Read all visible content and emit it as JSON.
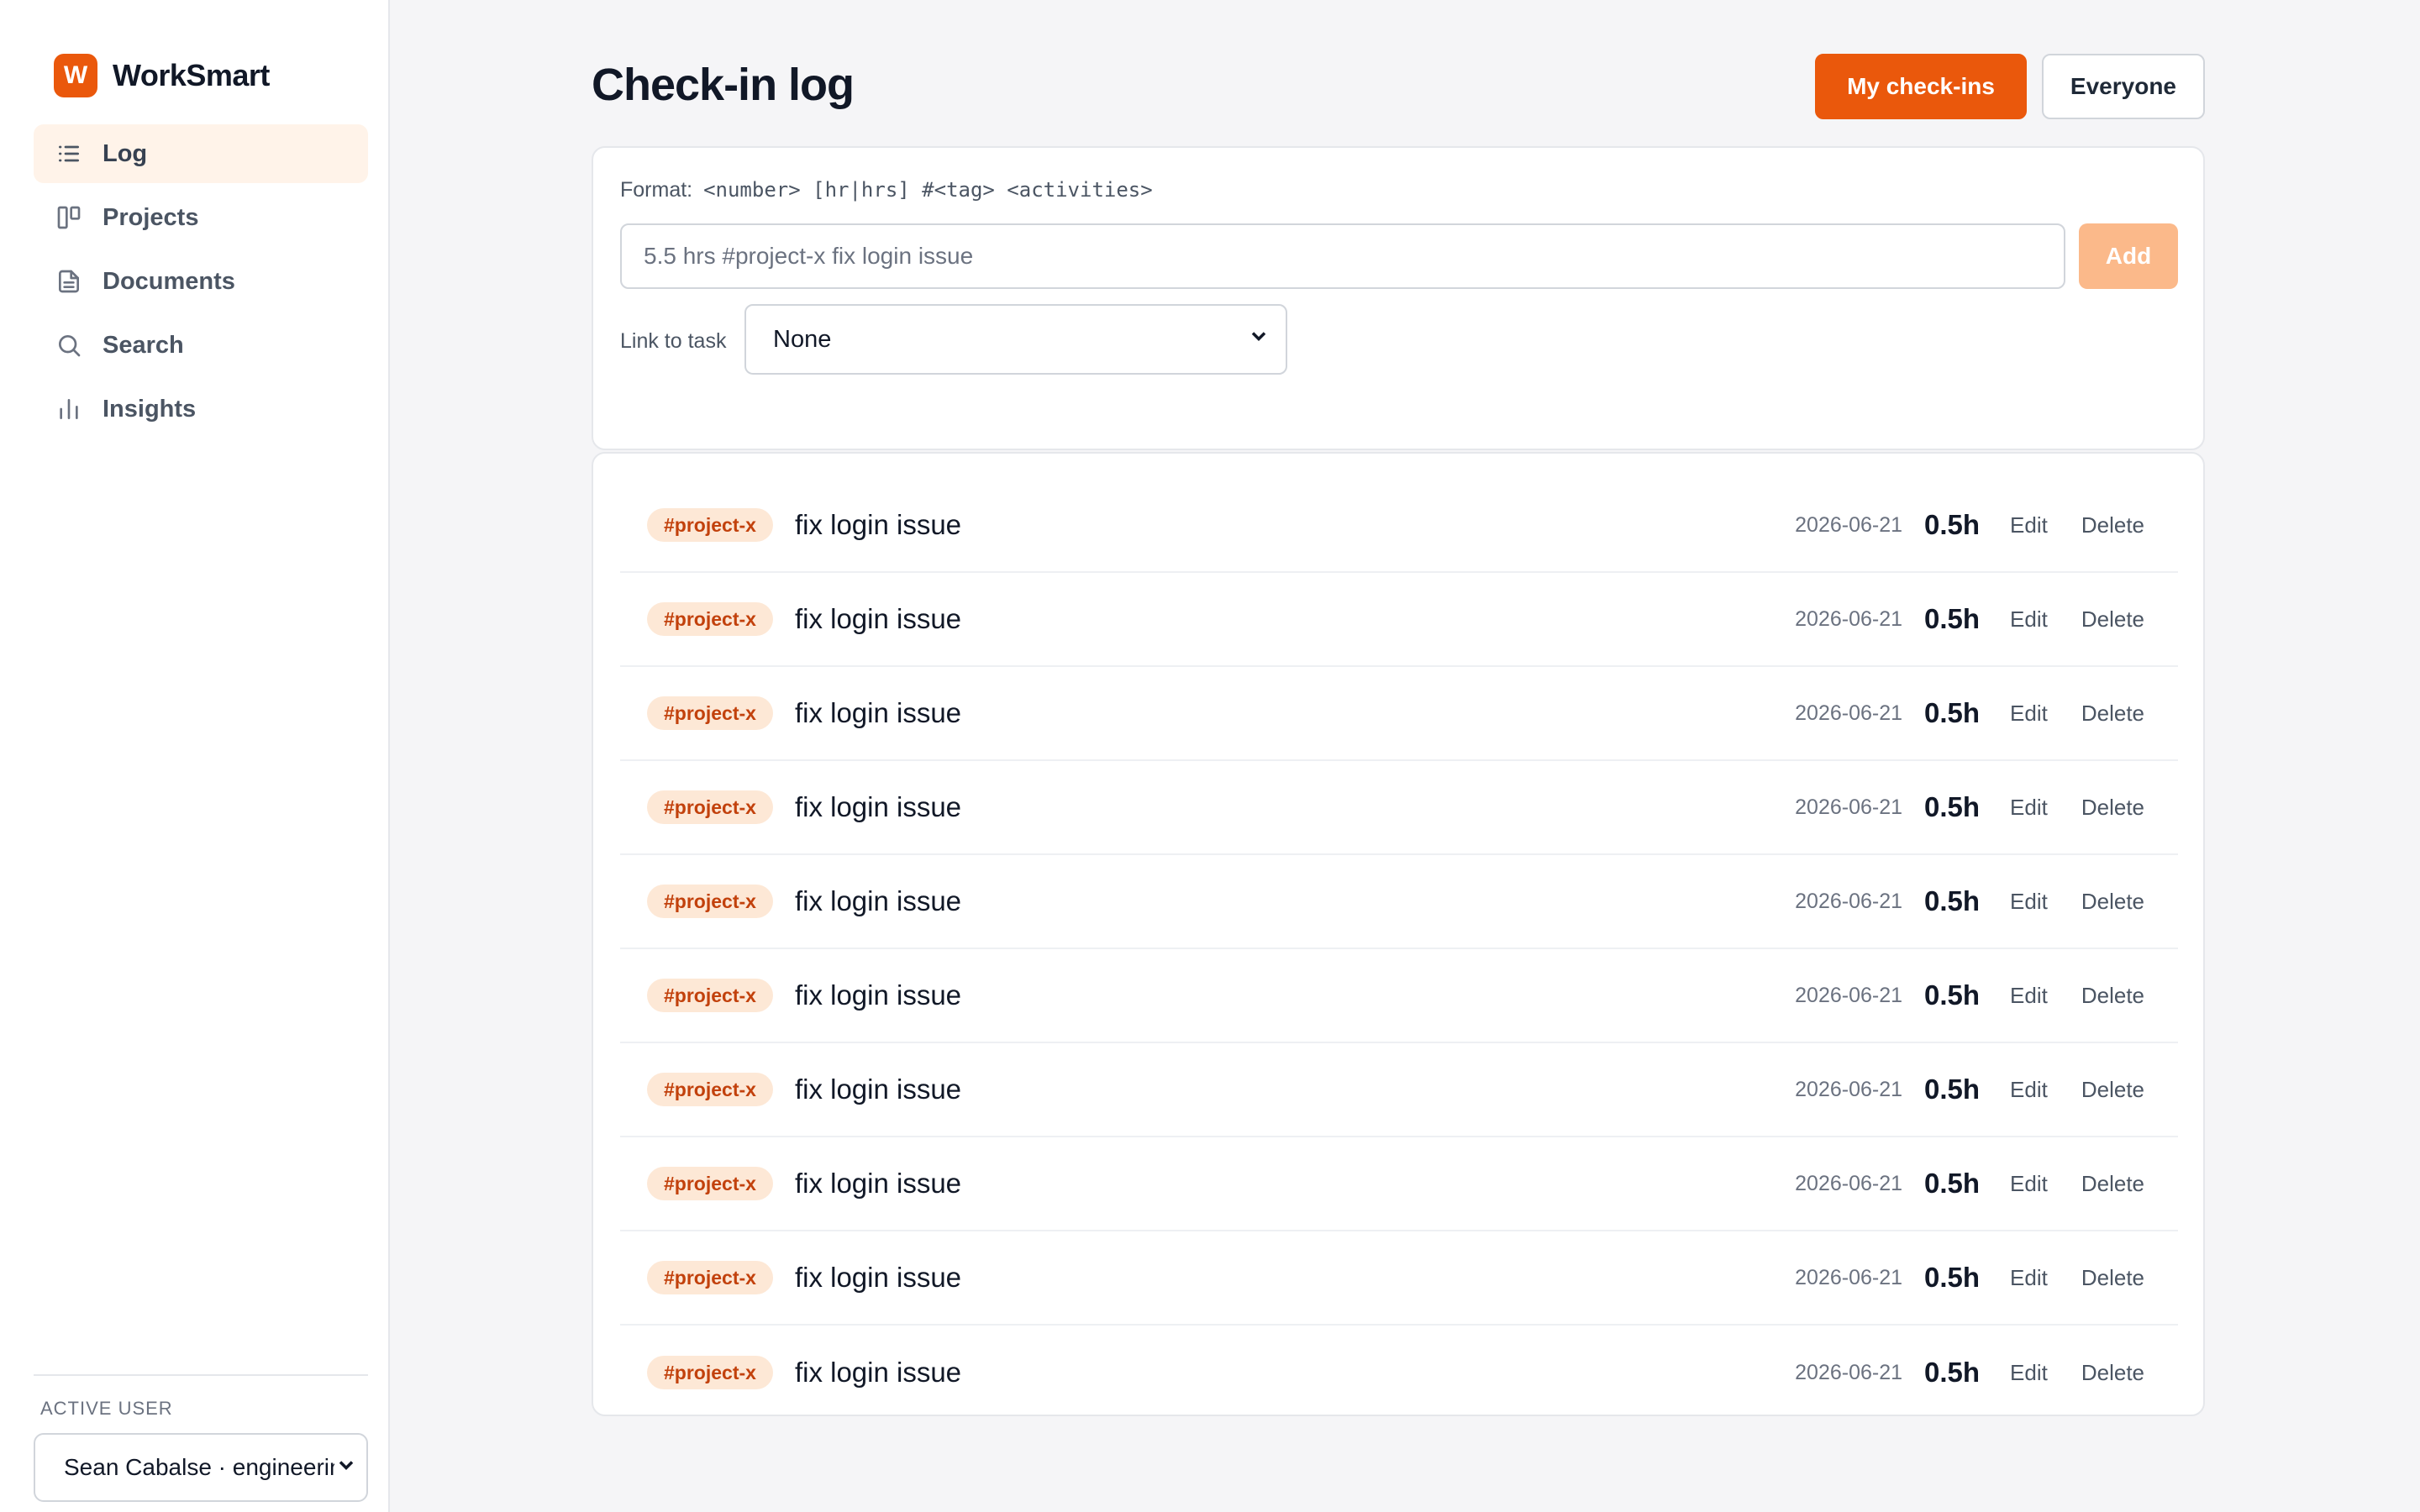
{
  "brand": {
    "logo_letter": "W",
    "name": "WorkSmart"
  },
  "sidebar": {
    "items": [
      {
        "label": "Log",
        "icon": "list-icon",
        "active": true
      },
      {
        "label": "Projects",
        "icon": "kanban-icon",
        "active": false
      },
      {
        "label": "Documents",
        "icon": "document-icon",
        "active": false
      },
      {
        "label": "Search",
        "icon": "search-icon",
        "active": false
      },
      {
        "label": "Insights",
        "icon": "bar-chart-icon",
        "active": false
      }
    ],
    "active_user_label": "ACTIVE USER",
    "active_user_value": "Sean Cabalse · engineering"
  },
  "header": {
    "title": "Check-in log",
    "toggle_mine": "My check-ins",
    "toggle_everyone": "Everyone"
  },
  "entry_form": {
    "format_label": "Format:",
    "format_syntax": "<number> [hr|hrs] #<tag> <activities>",
    "input_placeholder": "5.5 hrs #project-x fix login issue",
    "add_label": "Add",
    "link_label": "Link to task",
    "link_value": "None"
  },
  "checkins": [
    {
      "tag": "#project-x",
      "activity": "fix login issue",
      "date": "2026-06-21",
      "hours": "0.5h",
      "edit": "Edit",
      "delete": "Delete"
    },
    {
      "tag": "#project-x",
      "activity": "fix login issue",
      "date": "2026-06-21",
      "hours": "0.5h",
      "edit": "Edit",
      "delete": "Delete"
    },
    {
      "tag": "#project-x",
      "activity": "fix login issue",
      "date": "2026-06-21",
      "hours": "0.5h",
      "edit": "Edit",
      "delete": "Delete"
    },
    {
      "tag": "#project-x",
      "activity": "fix login issue",
      "date": "2026-06-21",
      "hours": "0.5h",
      "edit": "Edit",
      "delete": "Delete"
    },
    {
      "tag": "#project-x",
      "activity": "fix login issue",
      "date": "2026-06-21",
      "hours": "0.5h",
      "edit": "Edit",
      "delete": "Delete"
    },
    {
      "tag": "#project-x",
      "activity": "fix login issue",
      "date": "2026-06-21",
      "hours": "0.5h",
      "edit": "Edit",
      "delete": "Delete"
    },
    {
      "tag": "#project-x",
      "activity": "fix login issue",
      "date": "2026-06-21",
      "hours": "0.5h",
      "edit": "Edit",
      "delete": "Delete"
    },
    {
      "tag": "#project-x",
      "activity": "fix login issue",
      "date": "2026-06-21",
      "hours": "0.5h",
      "edit": "Edit",
      "delete": "Delete"
    },
    {
      "tag": "#project-x",
      "activity": "fix login issue",
      "date": "2026-06-21",
      "hours": "0.5h",
      "edit": "Edit",
      "delete": "Delete"
    },
    {
      "tag": "#project-x",
      "activity": "fix login issue",
      "date": "2026-06-21",
      "hours": "0.5h",
      "edit": "Edit",
      "delete": "Delete"
    }
  ],
  "colors": {
    "accent": "#ea580c",
    "accent_light": "#fbb98a",
    "tag_bg": "#fde8d6",
    "tag_text": "#c2410c"
  }
}
